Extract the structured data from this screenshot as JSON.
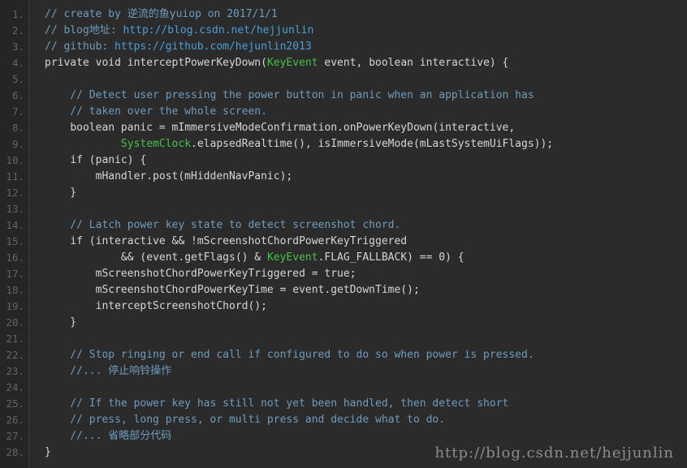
{
  "editor": {
    "background_color": "#2b2b2b",
    "gutter_background_color": "#252525",
    "line_number_color": "#636363",
    "total_lines": 28,
    "language": "java"
  },
  "colors": {
    "plain": "#d6d6d6",
    "comment": "#6d9cbe",
    "link": "#4a9fd8",
    "keyword": "#cc9900",
    "type": "#46c346",
    "number": "#8f3b3b",
    "watermark": "#8d8d8d"
  },
  "watermark": {
    "text": "http://blog.csdn.net/hejjunlin"
  },
  "line_numbers": [
    "1.",
    "2.",
    "3.",
    "4.",
    "5.",
    "6.",
    "7.",
    "8.",
    "9.",
    "10.",
    "11.",
    "12.",
    "13.",
    "14.",
    "15.",
    "16.",
    "17.",
    "18.",
    "19.",
    "20.",
    "21.",
    "22.",
    "23.",
    "24.",
    "25.",
    "26.",
    "27.",
    "28."
  ],
  "code_lines": [
    {
      "number": 1,
      "text": "// create by 逆流的鱼yuiop on 2017/1/1",
      "tokens": [
        {
          "t": "// create by ",
          "c": "comment"
        },
        {
          "t": "逆流的鱼",
          "c": "comment",
          "cjk": true
        },
        {
          "t": "yuiop on 2017/1/1",
          "c": "comment"
        }
      ]
    },
    {
      "number": 2,
      "text": "// blog地址: http://blog.csdn.net/hejjunlin",
      "tokens": [
        {
          "t": "// blog",
          "c": "comment"
        },
        {
          "t": "地址",
          "c": "comment",
          "cjk": true
        },
        {
          "t": ": ",
          "c": "comment"
        },
        {
          "t": "http://blog.csdn.net/hejjunlin",
          "c": "link"
        }
      ]
    },
    {
      "number": 3,
      "text": "// github: https://github.com/hejunlin2013",
      "tokens": [
        {
          "t": "// github: ",
          "c": "comment"
        },
        {
          "t": "https://github.com/hejunlin2013",
          "c": "link"
        }
      ]
    },
    {
      "number": 4,
      "text": "private void interceptPowerKeyDown(KeyEvent event, boolean interactive) {",
      "tokens": [
        {
          "t": "private void",
          "c": "keyword"
        },
        {
          "t": " interceptPowerKeyDown(",
          "c": "plain"
        },
        {
          "t": "KeyEvent",
          "c": "type"
        },
        {
          "t": " ",
          "c": "plain"
        },
        {
          "t": "event",
          "c": "keyword"
        },
        {
          "t": ", ",
          "c": "plain"
        },
        {
          "t": "boolean",
          "c": "keyword"
        },
        {
          "t": " interactive) {",
          "c": "plain"
        }
      ]
    },
    {
      "number": 5,
      "text": "",
      "tokens": []
    },
    {
      "number": 6,
      "text": "    // Detect user pressing the power button in panic when an application has",
      "tokens": [
        {
          "t": "    // Detect user pressing the power button in panic when an application has",
          "c": "comment"
        }
      ]
    },
    {
      "number": 7,
      "text": "    // taken over the whole screen.",
      "tokens": [
        {
          "t": "    // taken over the whole screen.",
          "c": "comment"
        }
      ]
    },
    {
      "number": 8,
      "text": "    boolean panic = mImmersiveModeConfirmation.onPowerKeyDown(interactive,",
      "tokens": [
        {
          "t": "    ",
          "c": "plain"
        },
        {
          "t": "boolean",
          "c": "keyword"
        },
        {
          "t": " panic = mImmersiveModeConfirmation.onPowerKeyDown(interactive,",
          "c": "plain"
        }
      ]
    },
    {
      "number": 9,
      "text": "            SystemClock.elapsedRealtime(), isImmersiveMode(mLastSystemUiFlags));",
      "tokens": [
        {
          "t": "            ",
          "c": "plain"
        },
        {
          "t": "SystemClock",
          "c": "type"
        },
        {
          "t": ".elapsedRealtime(), isImmersiveMode(mLastSystemUiFlags));",
          "c": "plain"
        }
      ]
    },
    {
      "number": 10,
      "text": "    if (panic) {",
      "tokens": [
        {
          "t": "    ",
          "c": "plain"
        },
        {
          "t": "if",
          "c": "keyword"
        },
        {
          "t": " (panic) {",
          "c": "plain"
        }
      ]
    },
    {
      "number": 11,
      "text": "        mHandler.post(mHiddenNavPanic);",
      "tokens": [
        {
          "t": "        mHandler.post(mHiddenNavPanic);",
          "c": "plain"
        }
      ]
    },
    {
      "number": 12,
      "text": "    }",
      "tokens": [
        {
          "t": "    }",
          "c": "plain"
        }
      ]
    },
    {
      "number": 13,
      "text": "",
      "tokens": []
    },
    {
      "number": 14,
      "text": "    // Latch power key state to detect screenshot chord.",
      "tokens": [
        {
          "t": "    // Latch power key state to detect screenshot chord.",
          "c": "comment"
        }
      ]
    },
    {
      "number": 15,
      "text": "    if (interactive && !mScreenshotChordPowerKeyTriggered",
      "tokens": [
        {
          "t": "    ",
          "c": "plain"
        },
        {
          "t": "if",
          "c": "keyword"
        },
        {
          "t": " (interactive && !mScreenshotChordPowerKeyTriggered",
          "c": "plain"
        }
      ]
    },
    {
      "number": 16,
      "text": "            && (event.getFlags() & KeyEvent.FLAG_FALLBACK) == 0) {",
      "tokens": [
        {
          "t": "            && (",
          "c": "plain"
        },
        {
          "t": "event",
          "c": "keyword"
        },
        {
          "t": ".getFlags() & ",
          "c": "plain"
        },
        {
          "t": "KeyEvent",
          "c": "type"
        },
        {
          "t": ".FLAG_FALLBACK) == ",
          "c": "plain"
        },
        {
          "t": "0",
          "c": "number"
        },
        {
          "t": ") {",
          "c": "plain"
        }
      ]
    },
    {
      "number": 17,
      "text": "        mScreenshotChordPowerKeyTriggered = true;",
      "tokens": [
        {
          "t": "        mScreenshotChordPowerKeyTriggered = ",
          "c": "plain"
        },
        {
          "t": "true",
          "c": "keyword"
        },
        {
          "t": ";",
          "c": "plain"
        }
      ]
    },
    {
      "number": 18,
      "text": "        mScreenshotChordPowerKeyTime = event.getDownTime();",
      "tokens": [
        {
          "t": "        mScreenshotChordPowerKeyTime = ",
          "c": "plain"
        },
        {
          "t": "event",
          "c": "keyword"
        },
        {
          "t": ".getDownTime();",
          "c": "plain"
        }
      ]
    },
    {
      "number": 19,
      "text": "        interceptScreenshotChord();",
      "tokens": [
        {
          "t": "        interceptScreenshotChord();",
          "c": "plain"
        }
      ]
    },
    {
      "number": 20,
      "text": "    }",
      "tokens": [
        {
          "t": "    }",
          "c": "plain"
        }
      ]
    },
    {
      "number": 21,
      "text": "",
      "tokens": []
    },
    {
      "number": 22,
      "text": "    // Stop ringing or end call if configured to do so when power is pressed.",
      "tokens": [
        {
          "t": "    // Stop ringing or end call if configured to do so when power is pressed.",
          "c": "comment"
        }
      ]
    },
    {
      "number": 23,
      "text": "    //... 停止响铃操作",
      "tokens": [
        {
          "t": "    //... ",
          "c": "comment"
        },
        {
          "t": "停止响铃操作",
          "c": "comment",
          "cjk": true
        }
      ]
    },
    {
      "number": 24,
      "text": "",
      "tokens": []
    },
    {
      "number": 25,
      "text": "    // If the power key has still not yet been handled, then detect short",
      "tokens": [
        {
          "t": "    // If the power key has still not yet been handled, then detect short",
          "c": "comment"
        }
      ]
    },
    {
      "number": 26,
      "text": "    // press, long press, or multi press and decide what to do.",
      "tokens": [
        {
          "t": "    // press, long press, or multi press and decide what to do.",
          "c": "comment"
        }
      ]
    },
    {
      "number": 27,
      "text": "    //... 省略部分代码",
      "tokens": [
        {
          "t": "    //... ",
          "c": "comment"
        },
        {
          "t": "省略部分代码",
          "c": "comment",
          "cjk": true
        }
      ]
    },
    {
      "number": 28,
      "text": "}",
      "tokens": [
        {
          "t": "}",
          "c": "plain"
        }
      ]
    }
  ]
}
